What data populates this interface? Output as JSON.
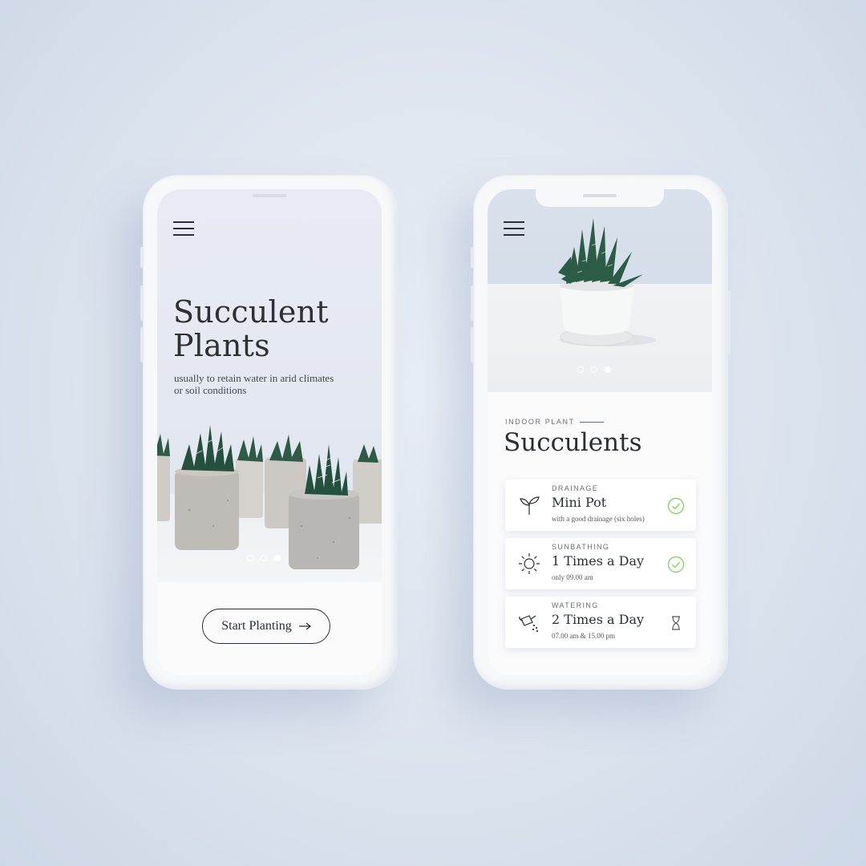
{
  "left_screen": {
    "title_line1": "Succulent",
    "title_line2": "Plants",
    "subtitle": "usually to retain water in arid climates or soil conditions",
    "carousel": {
      "count": 3,
      "active_index": 2
    },
    "cta_label": "Start Planting",
    "cta_icon": "arrow-right-icon"
  },
  "right_screen": {
    "carousel": {
      "count": 3,
      "active_index": 2
    },
    "section_label": "INDOOR PLANT",
    "section_title": "Succulents",
    "cards": [
      {
        "icon": "sprout-icon",
        "category": "DRAINAGE",
        "value": "Mini Pot",
        "note": "with a good drainage (six holes)",
        "status": "check-circle-icon"
      },
      {
        "icon": "sun-icon",
        "category": "SUNBATHING",
        "value": "1 Times a Day",
        "note": "only 09.00 am",
        "status": "check-circle-icon"
      },
      {
        "icon": "watering-can-icon",
        "category": "WATERING",
        "value": "2 Times a Day",
        "note": "07.00 am & 15.00 pm",
        "status": "hourglass-icon"
      }
    ]
  },
  "colors": {
    "accent_check": "#8bd16a",
    "text_dark": "#2a2f33",
    "background": "#dfe6f0"
  }
}
